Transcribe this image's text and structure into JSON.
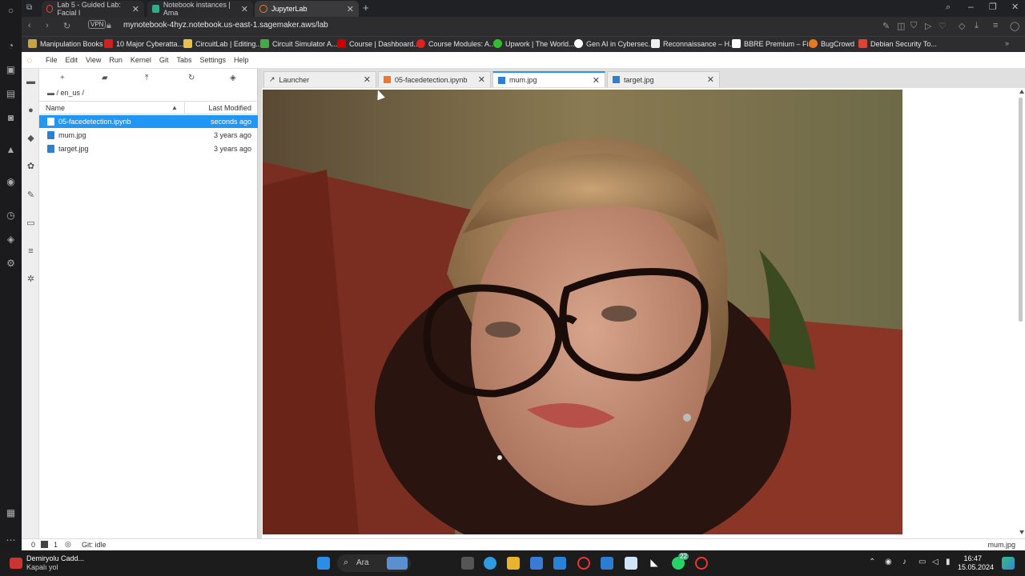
{
  "browser": {
    "tabs": [
      {
        "label": "Lab 5 - Guided Lab: Facial I"
      },
      {
        "label": "Notebook instances | Ama"
      },
      {
        "label": "JupyterLab"
      }
    ],
    "vpn_badge": "VPN",
    "url": "mynotebook-4hyz.notebook.us-east-1.sagemaker.aws/lab",
    "bookmarks": [
      "Manipulation Books",
      "10 Major Cyberatta...",
      "CircuitLab | Editing...",
      "Circuit Simulator A...",
      "Course | Dashboard...",
      "Course Modules: A...",
      "Upwork | The World...",
      "Gen AI in Cybersec...",
      "Reconnaissance – H...",
      "BBRE Premium – Fi...",
      "BugCrowd",
      "Debian Security To..."
    ]
  },
  "jupyter": {
    "menu": [
      "File",
      "Edit",
      "View",
      "Run",
      "Kernel",
      "Git",
      "Tabs",
      "Settings",
      "Help"
    ],
    "toolbar_add": "+",
    "breadcrumb": "/ en_us /",
    "filebrowser": {
      "col_name": "Name",
      "col_modified": "Last Modified",
      "files": [
        {
          "name": "05-facedetection.ipynb",
          "modified": "seconds ago"
        },
        {
          "name": "mum.jpg",
          "modified": "3 years ago"
        },
        {
          "name": "target.jpg",
          "modified": "3 years ago"
        }
      ]
    },
    "doc_tabs": [
      {
        "label": "Launcher"
      },
      {
        "label": "05-facedetection.ipynb"
      },
      {
        "label": "mum.jpg"
      },
      {
        "label": "target.jpg"
      }
    ],
    "status": {
      "count_a": "0",
      "count_b": "1",
      "git": "Git: idle",
      "right": "mum.jpg"
    }
  },
  "taskbar": {
    "weather_line1": "Demiryolu Cadd...",
    "weather_line2": "Kapalı yol",
    "search_label": "Ara",
    "time": "16:47",
    "date": "15.05.2024",
    "badge_count": "22"
  }
}
